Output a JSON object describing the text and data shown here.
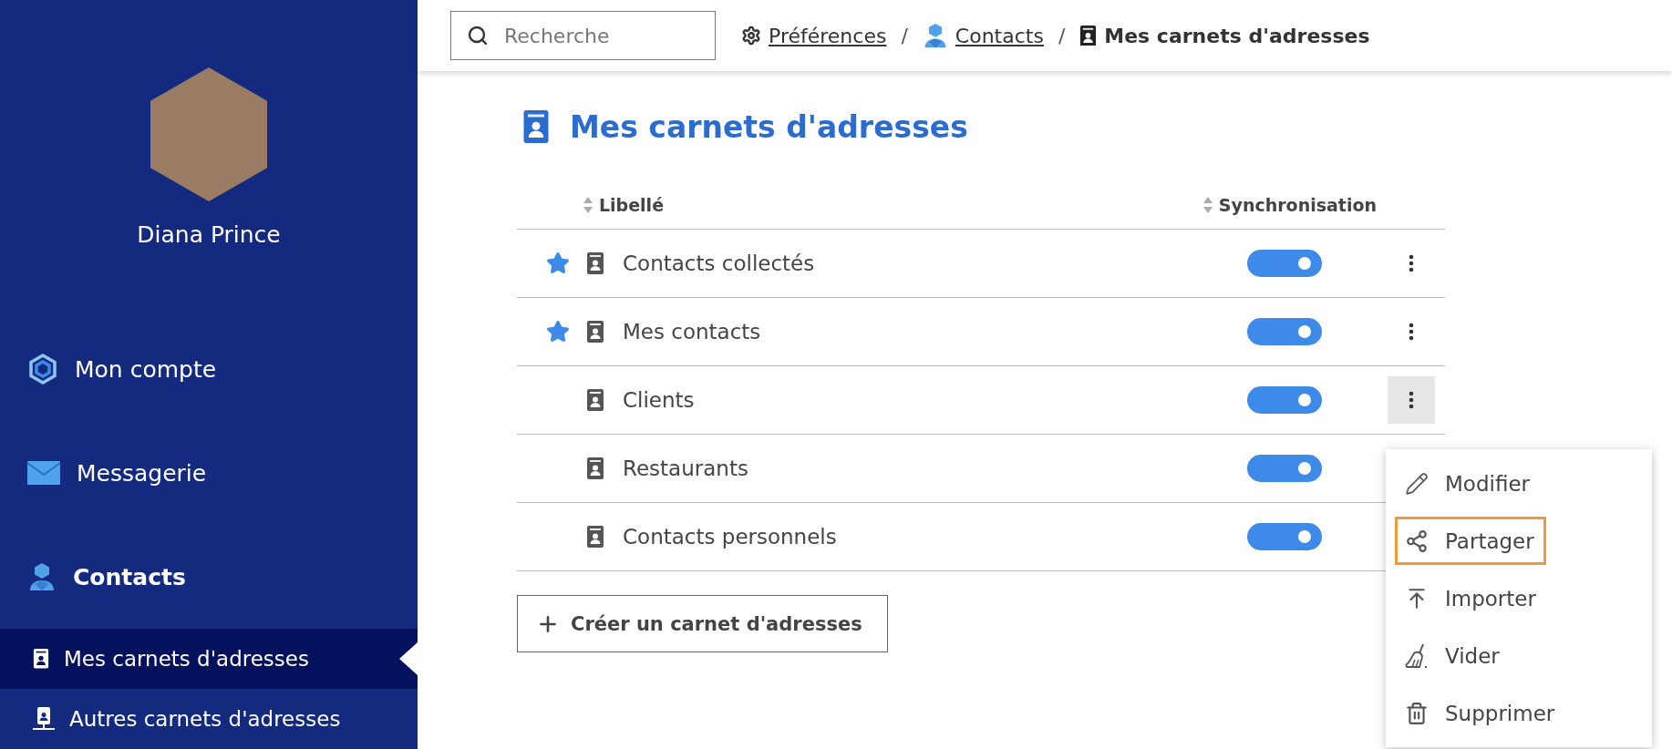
{
  "sidebar": {
    "user_name": "Diana Prince",
    "items": [
      {
        "label": "Mon compte",
        "selected": false
      },
      {
        "label": "Messagerie",
        "selected": false
      },
      {
        "label": "Contacts",
        "selected": true,
        "children": [
          {
            "label": "Mes carnets d'adresses",
            "selected": true
          },
          {
            "label": "Autres carnets d'adresses",
            "selected": false
          }
        ]
      }
    ]
  },
  "search": {
    "placeholder": "Recherche"
  },
  "breadcrumb": [
    {
      "label": "Préférences",
      "selected": false
    },
    {
      "label": "Contacts",
      "selected": false
    },
    {
      "label": "Mes carnets d'adresses",
      "selected": true
    }
  ],
  "breadcrumb_separator": "/",
  "page_title": "Mes carnets d'adresses",
  "table": {
    "columns": [
      "Libellé",
      "Synchronisation"
    ],
    "rows": [
      {
        "name": "Contacts collectés",
        "starred": true,
        "sync": true,
        "menu_open": false
      },
      {
        "name": "Mes contacts",
        "starred": true,
        "sync": true,
        "menu_open": false
      },
      {
        "name": "Clients",
        "starred": false,
        "sync": true,
        "menu_open": true
      },
      {
        "name": "Restaurants",
        "starred": false,
        "sync": true,
        "menu_open": false
      },
      {
        "name": "Contacts personnels",
        "starred": false,
        "sync": true,
        "menu_open": false
      }
    ]
  },
  "create_button": "Créer un carnet d'adresses",
  "context_menu": [
    {
      "label": "Modifier",
      "selected": false
    },
    {
      "label": "Partager",
      "selected": true
    },
    {
      "label": "Importer",
      "selected": false
    },
    {
      "label": "Vider",
      "selected": false
    },
    {
      "label": "Supprimer",
      "selected": false
    }
  ]
}
